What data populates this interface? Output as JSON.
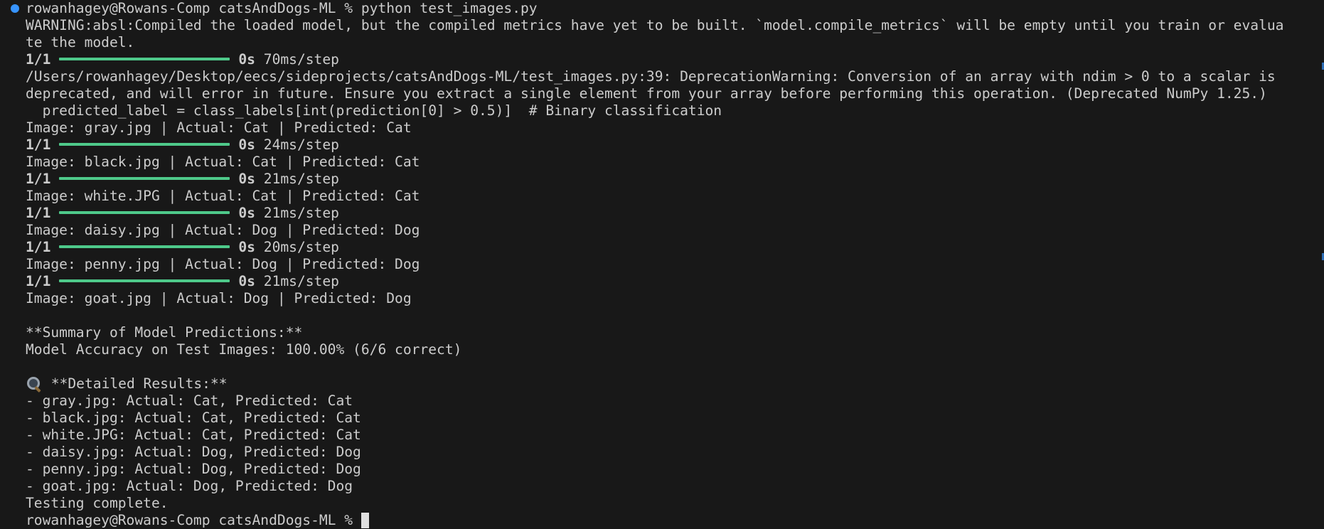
{
  "colors": {
    "background": "#181818",
    "text": "#cccccc",
    "progress_bar": "#4ec98a",
    "prompt_dot": "#3794ff",
    "cursor": "#e0e0e0"
  },
  "prompt": {
    "text": "rowanhagey@Rowans-Comp catsAndDogs-ML % python test_images.py"
  },
  "warning": {
    "line1": "WARNING:absl:Compiled the loaded model, but the compiled metrics have yet to be built. `model.compile_metrics` will be empty until you train or evalua",
    "line2": "te the model."
  },
  "steps": [
    {
      "count": "1/1",
      "time": "0s",
      "rate": "70ms/step",
      "progress": 1.0
    },
    {
      "count": "1/1",
      "time": "0s",
      "rate": "24ms/step",
      "progress": 1.0
    },
    {
      "count": "1/1",
      "time": "0s",
      "rate": "21ms/step",
      "progress": 1.0
    },
    {
      "count": "1/1",
      "time": "0s",
      "rate": "21ms/step",
      "progress": 1.0
    },
    {
      "count": "1/1",
      "time": "0s",
      "rate": "20ms/step",
      "progress": 1.0
    },
    {
      "count": "1/1",
      "time": "0s",
      "rate": "21ms/step",
      "progress": 1.0
    }
  ],
  "deprecation": {
    "line1": "/Users/rowanhagey/Desktop/eecs/sideprojects/catsAndDogs-ML/test_images.py:39: DeprecationWarning: Conversion of an array with ndim > 0 to a scalar is",
    "line2": "deprecated, and will error in future. Ensure you extract a single element from your array before performing this operation. (Deprecated NumPy 1.25.)",
    "line3": "  predicted_label = class_labels[int(prediction[0] > 0.5)]  # Binary classification"
  },
  "results": [
    "Image: gray.jpg | Actual: Cat | Predicted: Cat",
    "Image: black.jpg | Actual: Cat | Predicted: Cat",
    "Image: white.JPG | Actual: Cat | Predicted: Cat",
    "Image: daisy.jpg | Actual: Dog | Predicted: Dog",
    "Image: penny.jpg | Actual: Dog | Predicted: Dog",
    "Image: goat.jpg | Actual: Dog | Predicted: Dog"
  ],
  "summary": {
    "heading": "**Summary of Model Predictions:**",
    "accuracy": "Model Accuracy on Test Images: 100.00% (6/6 correct)"
  },
  "detailed": {
    "icon": "magnifying-glass-icon",
    "heading": " **Detailed Results:**",
    "items": [
      "- gray.jpg: Actual: Cat, Predicted: Cat",
      "- black.jpg: Actual: Cat, Predicted: Cat",
      "- white.JPG: Actual: Cat, Predicted: Cat",
      "- daisy.jpg: Actual: Dog, Predicted: Dog",
      "- penny.jpg: Actual: Dog, Predicted: Dog",
      "- goat.jpg: Actual: Dog, Predicted: Dog"
    ]
  },
  "footer": {
    "complete": "Testing complete.",
    "next_prompt": "rowanhagey@Rowans-Comp catsAndDogs-ML % "
  }
}
